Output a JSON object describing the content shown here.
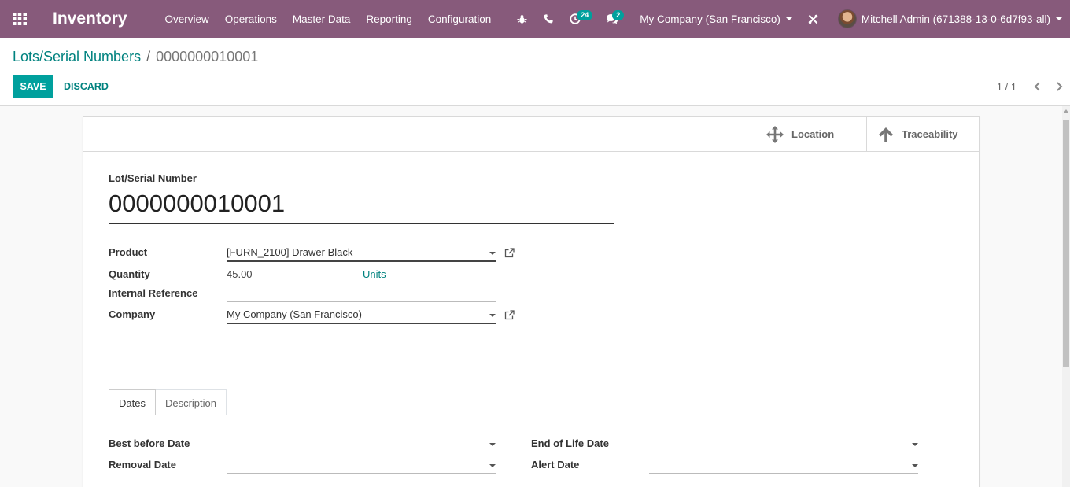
{
  "navbar": {
    "app_title": "Inventory",
    "menu": [
      "Overview",
      "Operations",
      "Master Data",
      "Reporting",
      "Configuration"
    ],
    "activity_count": "24",
    "message_count": "2",
    "company": "My Company (San Francisco)",
    "user": "Mitchell Admin (671388-13-0-6d7f93-all)"
  },
  "control_panel": {
    "breadcrumb_parent": "Lots/Serial Numbers",
    "breadcrumb_current": "0000000010001",
    "save_label": "SAVE",
    "discard_label": "DISCARD",
    "pager_value": "1 / 1"
  },
  "smart_buttons": {
    "location_label": "Location",
    "traceability_label": "Traceability"
  },
  "form": {
    "name_label": "Lot/Serial Number",
    "name_value": "0000000010001",
    "product_label": "Product",
    "product_value": "[FURN_2100] Drawer Black",
    "quantity_label": "Quantity",
    "quantity_value": "45.00",
    "quantity_uom": "Units",
    "internal_ref_label": "Internal Reference",
    "internal_ref_value": "",
    "company_label": "Company",
    "company_value": "My Company (San Francisco)"
  },
  "tabs": [
    "Dates",
    "Description"
  ],
  "dates": {
    "best_before_label": "Best before Date",
    "removal_label": "Removal Date",
    "end_of_life_label": "End of Life Date",
    "alert_label": "Alert Date"
  },
  "colors": {
    "navbar": "#875a7b",
    "primary": "#00a09d",
    "link": "#00827f"
  }
}
